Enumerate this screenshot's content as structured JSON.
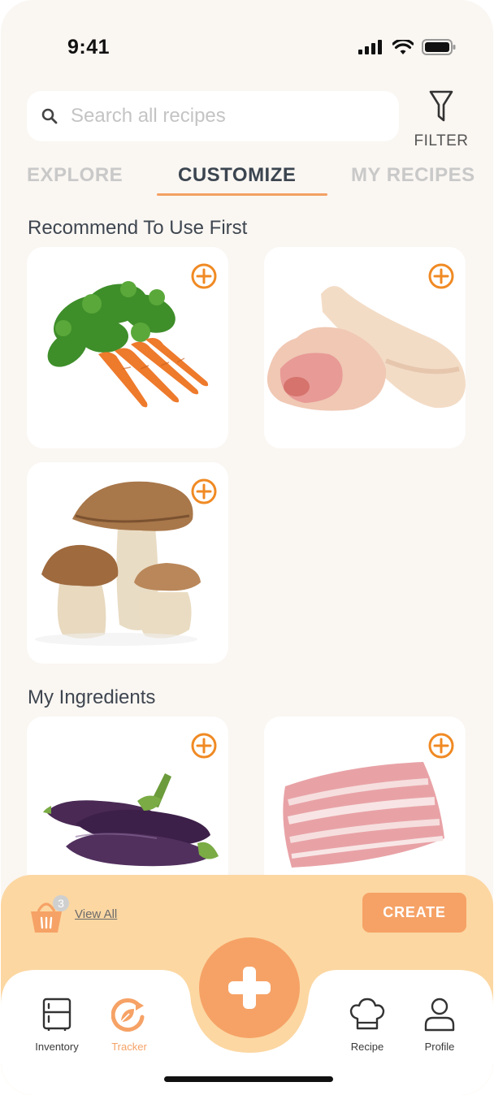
{
  "status_bar": {
    "time": "9:41"
  },
  "search": {
    "placeholder": "Search all recipes",
    "value": ""
  },
  "filter": {
    "label": "FILTER"
  },
  "tabs": [
    {
      "label": "EXPLORE",
      "active": false
    },
    {
      "label": "CUSTOMIZE",
      "active": true
    },
    {
      "label": "MY RECIPES",
      "active": false
    }
  ],
  "sections": {
    "recommend_title": "Recommend To Use First",
    "recommend_items": [
      {
        "name": "carrots",
        "icon": "add-circle-icon"
      },
      {
        "name": "chicken drumsticks",
        "icon": "add-circle-icon"
      },
      {
        "name": "porcini mushrooms",
        "icon": "add-circle-icon"
      }
    ],
    "ingredients_title": "My Ingredients",
    "ingredient_items": [
      {
        "name": "eggplants",
        "icon": "add-circle-icon"
      },
      {
        "name": "pork belly",
        "icon": "add-circle-icon"
      }
    ]
  },
  "basket": {
    "count": "3",
    "view_all": "View All",
    "create": "CREATE"
  },
  "nav": {
    "items": [
      {
        "label": "Inventory",
        "icon": "fridge-icon",
        "active": false
      },
      {
        "label": "Tracker",
        "icon": "tracker-icon",
        "active": true
      },
      {
        "label": "Recipe",
        "icon": "chef-hat-icon",
        "active": false
      },
      {
        "label": "Profile",
        "icon": "profile-icon",
        "active": false
      }
    ],
    "fab_icon": "plus-icon"
  },
  "colors": {
    "accent": "#f6a266",
    "basket_bar": "#fcd7a2",
    "background": "#faf6f2",
    "add_icon": "#f08a24"
  }
}
